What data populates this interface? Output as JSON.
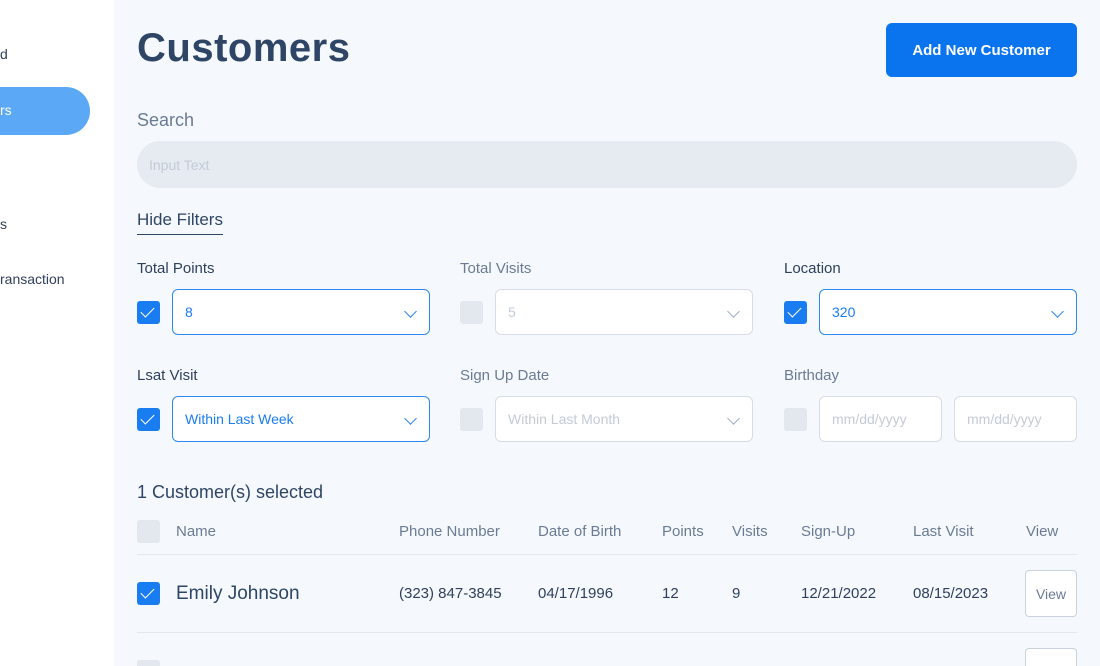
{
  "sidebar": {
    "items": [
      {
        "label": "d"
      },
      {
        "label": "rs"
      },
      {
        "label": "s"
      },
      {
        "label": "ransaction"
      }
    ]
  },
  "header": {
    "title": "Customers",
    "add_button": "Add New Customer"
  },
  "search": {
    "label": "Search",
    "placeholder": "Input Text"
  },
  "filters": {
    "toggle_label": "Hide Filters",
    "total_points": {
      "label": "Total Points",
      "value": "8",
      "checked": true
    },
    "total_visits": {
      "label": "Total Visits",
      "value": "5",
      "checked": false
    },
    "location": {
      "label": "Location",
      "value": "320",
      "checked": true
    },
    "last_visit": {
      "label": "Lsat Visit",
      "value": "Within Last Week",
      "checked": true
    },
    "sign_up_date": {
      "label": "Sign Up Date",
      "value": "Within Last Month",
      "checked": false
    },
    "birthday": {
      "label": "Birthday",
      "from_placeholder": "mm/dd/yyyy",
      "to_placeholder": "mm/dd/yyyy",
      "checked": false
    }
  },
  "table": {
    "selected_text": "1 Customer(s) selected",
    "columns": [
      "Name",
      "Phone Number",
      "Date of Birth",
      "Points",
      "Visits",
      "Sign-Up",
      "Last Visit",
      "View"
    ],
    "rows": [
      {
        "checked": true,
        "name": "Emily Johnson",
        "phone": "(323) 847-3845",
        "dob": "04/17/1996",
        "points": "12",
        "visits": "9",
        "signup": "12/21/2022",
        "last_visit": "08/15/2023",
        "view": "View"
      }
    ]
  },
  "colors": {
    "accent": "#0a74ef",
    "sidebar_active": "#5aa8f6",
    "text": "#2f4566"
  }
}
